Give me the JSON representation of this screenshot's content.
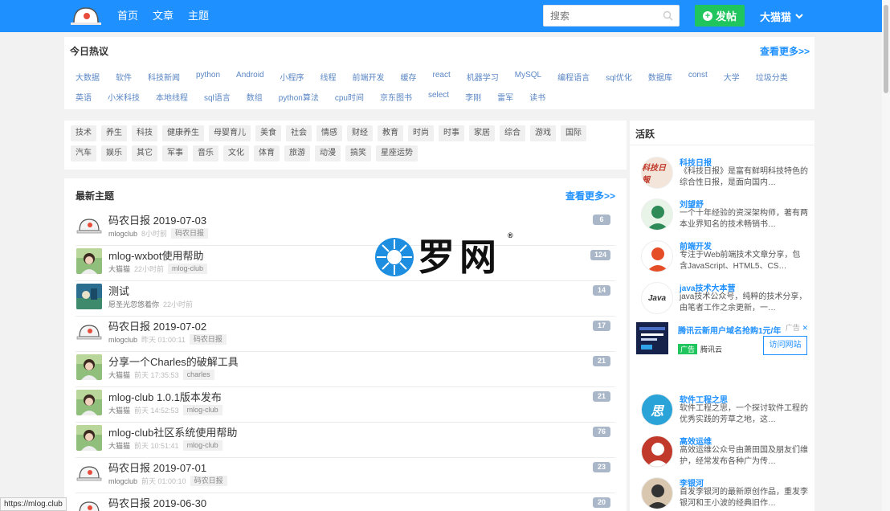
{
  "nav": {
    "items": [
      "首页",
      "文章",
      "主题"
    ]
  },
  "search": {
    "placeholder": "搜索"
  },
  "post_button": {
    "label": "发帖"
  },
  "user_menu": {
    "name": "大猫猫"
  },
  "hot": {
    "title": "今日热议",
    "more": "查看更多>>",
    "row1": [
      "大数据",
      "软件",
      "科技新闻",
      "python",
      "Android",
      "小程序",
      "线程",
      "前端开发",
      "缓存",
      "react",
      "机器学习",
      "MySQL",
      "编程语言",
      "sql优化",
      "数据库",
      "const",
      "大学",
      "垃圾分类"
    ],
    "row2": [
      "英语",
      "小米科技",
      "本地线程",
      "sql语言",
      "数组",
      "python算法",
      "cpu时间",
      "京东图书",
      "select",
      "李刚",
      "雷军",
      "读书"
    ]
  },
  "categories": {
    "row1": [
      "技术",
      "养生",
      "科技",
      "健康养生",
      "母婴育儿",
      "美食",
      "社会",
      "情感",
      "财经",
      "教育",
      "时尚",
      "时事",
      "家居",
      "综合",
      "游戏",
      "国际"
    ],
    "row2": [
      "汽车",
      "娱乐",
      "其它",
      "军事",
      "音乐",
      "文化",
      "体育",
      "旅游",
      "动漫",
      "搞笑",
      "星座运势"
    ]
  },
  "latest": {
    "title": "最新主题",
    "more": "查看更多>>",
    "topics": [
      {
        "title": "码农日报 2019-07-03",
        "author": "mlogclub",
        "time": "8小时前",
        "tag": "码农日报",
        "count": "6",
        "avatar": "logo"
      },
      {
        "title": "mlog-wxbot使用帮助",
        "author": "大猫猫",
        "time": "22小时前",
        "tag": "mlog-club",
        "count": "124",
        "avatar": "girl"
      },
      {
        "title": "测试",
        "author": "愿圣光忽悠着你",
        "time": "22小时前",
        "tag": "",
        "count": "14",
        "avatar": "scene"
      },
      {
        "title": "码农日报 2019-07-02",
        "author": "mlogclub",
        "time": "昨天 01:00:11",
        "tag": "码农日报",
        "count": "17",
        "avatar": "logo"
      },
      {
        "title": "分享一个Charles的破解工具",
        "author": "大猫猫",
        "time": "前天 17:35:53",
        "tag": "charles",
        "count": "21",
        "avatar": "girl"
      },
      {
        "title": "mlog-club 1.0.1版本发布",
        "author": "大猫猫",
        "time": "前天 14:52:53",
        "tag": "mlog-club",
        "count": "21",
        "avatar": "girl"
      },
      {
        "title": "mlog-club社区系统使用帮助",
        "author": "大猫猫",
        "time": "前天 10:51:41",
        "tag": "mlog-club",
        "count": "76",
        "avatar": "girl"
      },
      {
        "title": "码农日报 2019-07-01",
        "author": "mlogclub",
        "time": "前天 01:00:10",
        "tag": "码农日报",
        "count": "23",
        "avatar": "logo"
      },
      {
        "title": "码农日报 2019-06-30",
        "author": "",
        "time": "",
        "tag": "",
        "count": "20",
        "avatar": "logo"
      }
    ]
  },
  "active": {
    "title": "活跃",
    "users": [
      {
        "name": "科技日报",
        "desc": "《科技日报》是富有鲜明科技特色的综合性日报，是面向国内…",
        "avatar_text": "科技日報",
        "color": "#f3e5da",
        "fg": "#c0392b"
      },
      {
        "name": "刘望舒",
        "desc": "一个十年经验的资深架构师，著有两本业界知名的技术畅销书…",
        "avatar_text": "",
        "color": "#e8f4e8",
        "fg": "#2e8b57"
      },
      {
        "name": "前端开发",
        "desc": "专注于Web前端技术文章分享，包含JavaScript、HTML5、CS…",
        "avatar_text": "",
        "color": "#ffffff",
        "fg": "#e44d26"
      },
      {
        "name": "java技术大本营",
        "desc": "java技术公众号，纯粹的技术分享，由笔者工作之余更新，一…",
        "avatar_text": "Java",
        "color": "#ffffff",
        "fg": "#333333"
      }
    ],
    "ad": {
      "title": "腾讯云新用户域名抢购1元/年",
      "badge": "广告",
      "brand_tag": "广告",
      "brand": "腾讯云",
      "button": "访问网站"
    },
    "users2": [
      {
        "name": "软件工程之思",
        "desc": "软件工程之思，一个探讨软件工程的优秀实践的芳草之地，这…",
        "avatar_text": "思",
        "color": "#2aa3d8",
        "fg": "#ffffff"
      },
      {
        "name": "高效运维",
        "desc": "高效运维公众号由萧田国及朋友们维护，经常发布各种广为传…",
        "avatar_text": "",
        "color": "#c0392b",
        "fg": "#ffffff"
      },
      {
        "name": "李银河",
        "desc": "首发李银河的最新原创作品，重发李银河和王小波的经典旧作…",
        "avatar_text": "",
        "color": "#d9c7b0",
        "fg": "#333333"
      }
    ]
  },
  "statusbar": {
    "url": "https://mlog.club"
  },
  "watermark": {
    "text": "罗网"
  }
}
